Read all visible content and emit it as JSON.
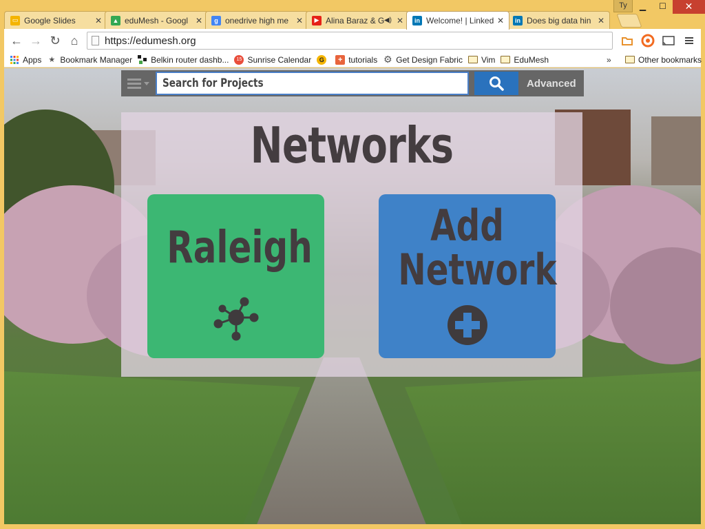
{
  "window": {
    "user_badge": "Ty",
    "minimize": "▁",
    "maximize": "☐",
    "close": "✕"
  },
  "tabs": [
    {
      "title": "Google Slides",
      "favicon_color": "#f4b400",
      "active": false
    },
    {
      "title": "eduMesh - Googl",
      "favicon_color": "#34a853",
      "active": false
    },
    {
      "title": "onedrive high me",
      "favicon_color": "#4285f4",
      "active": false
    },
    {
      "title": "Alina Baraz & G",
      "favicon_color": "#e62117",
      "active": false
    },
    {
      "title": "Welcome! | Linked",
      "favicon_color": "#0077b5",
      "active": true
    },
    {
      "title": "Does big data hin",
      "favicon_color": "#0077b5",
      "active": false
    }
  ],
  "toolbar": {
    "url": "https://edumesh.org",
    "back": "←",
    "forward": "→",
    "reload": "↻",
    "home": "⌂"
  },
  "bookmarks": {
    "items": [
      {
        "label": "Apps",
        "icon": "apps-grid-icon"
      },
      {
        "label": "Bookmark Manager",
        "icon": "star-icon"
      },
      {
        "label": "Belkin router dashb...",
        "icon": "belkin-icon"
      },
      {
        "label": "Sunrise Calendar",
        "icon": "sunrise-calendar-icon",
        "badge": "15"
      },
      {
        "label": "",
        "icon": "grammarly-icon"
      },
      {
        "label": "tutorials",
        "icon": "plus-square-icon"
      },
      {
        "label": "Get Design Fabric",
        "icon": "gear-icon"
      },
      {
        "label": "Vim",
        "icon": "folder-icon"
      },
      {
        "label": "EduMesh",
        "icon": "folder-icon"
      }
    ],
    "overflow": "»",
    "other": "Other bookmarks"
  },
  "search": {
    "placeholder": "Search for Projects",
    "advanced_label": "Advanced"
  },
  "networks": {
    "title": "Networks",
    "cards": [
      {
        "label": "Raleigh",
        "color": "#3cb773",
        "icon": "network-hub-icon"
      },
      {
        "label_line1": "Add",
        "label_line2": "Network",
        "color": "#3f82c8",
        "icon": "plus-circle-icon"
      }
    ]
  }
}
